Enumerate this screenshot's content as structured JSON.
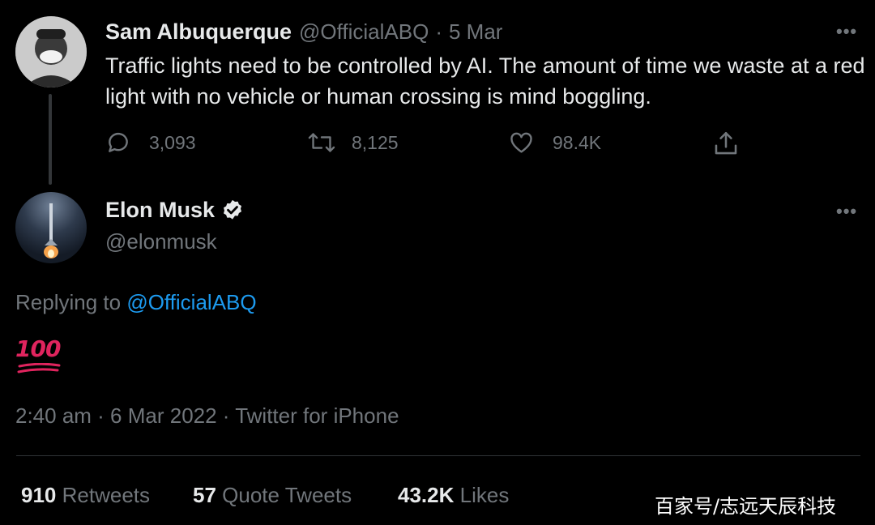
{
  "original_tweet": {
    "author_name": "Sam Albuquerque",
    "handle": "@OfficialABQ",
    "separator": "·",
    "date": "5 Mar",
    "text": "Traffic lights need to be controlled by AI. The amount of time we waste at a red light with no vehicle or human crossing is mind boggling.",
    "more_icon": "more-horizontal-icon",
    "actions": {
      "replies": "3,093",
      "retweets": "8,125",
      "likes": "98.4K"
    }
  },
  "reply_tweet": {
    "author_name": "Elon Musk",
    "handle": "@elonmusk",
    "verified_icon": "verified-badge-icon",
    "replying_prefix": "Replying to",
    "replying_to": "@OfficialABQ",
    "emoji_text": "100",
    "timestamp": "2:40 am · 6 Mar 2022 · Twitter for iPhone"
  },
  "stats": {
    "retweets_count": "910",
    "retweets_label": "Retweets",
    "quotes_count": "57",
    "quotes_label": "Quote Tweets",
    "likes_count": "43.2K",
    "likes_label": "Likes"
  },
  "watermark": "百家号/志远天辰科技",
  "colors": {
    "background": "#000000",
    "text": "#e7e9ea",
    "muted": "#71767b",
    "link": "#1d9bf0",
    "emoji_red": "#e0245e"
  }
}
